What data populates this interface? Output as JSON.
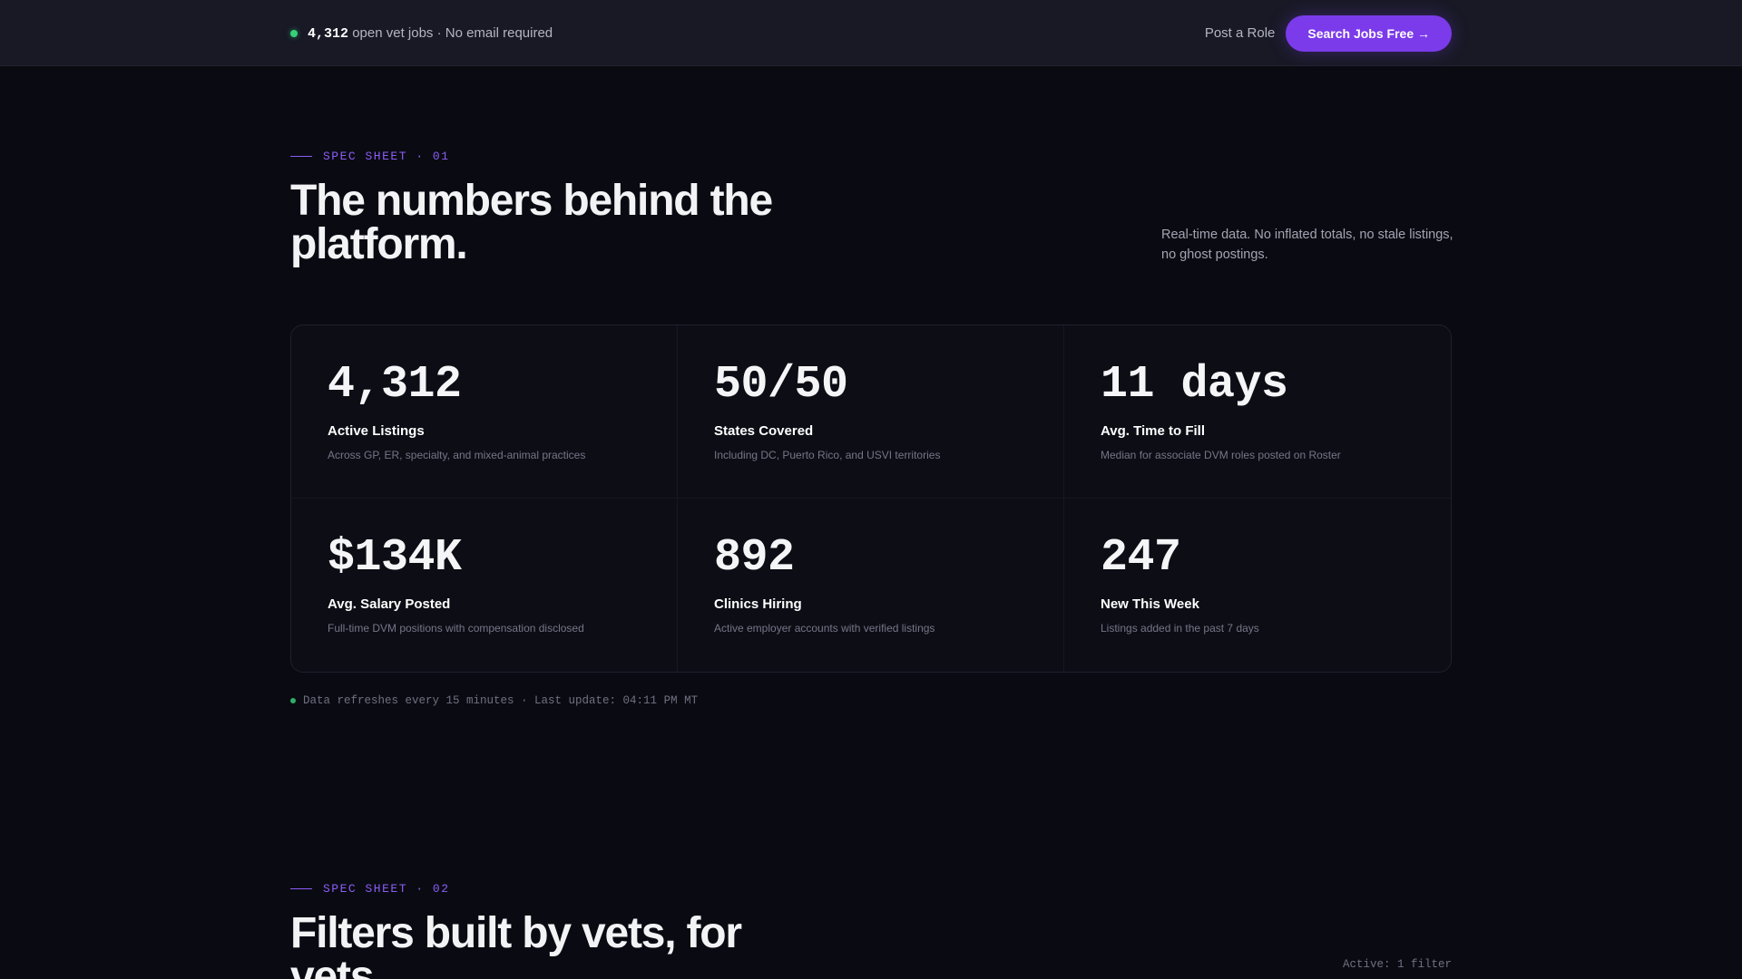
{
  "topbar": {
    "open_count": "4,312",
    "open_text": "open vet jobs · No email required",
    "post_role": "Post a Role",
    "search_button": "Search Jobs Free →"
  },
  "section1": {
    "eyebrow": "SPEC SHEET · 01",
    "title_line1": "The numbers behind the",
    "title_line2": "platform.",
    "description": "Real-time data. No inflated totals, no stale listings, no ghost postings.",
    "stats": [
      {
        "value": "4,312",
        "label": "Active Listings",
        "sub": "Across GP, ER, specialty, and mixed-animal practices"
      },
      {
        "value": "50/50",
        "label": "States Covered",
        "sub": "Including DC, Puerto Rico, and USVI territories"
      },
      {
        "value": "11 days",
        "label": "Avg. Time to Fill",
        "sub": "Median for associate DVM roles posted on Roster"
      },
      {
        "value": "$134K",
        "label": "Avg. Salary Posted",
        "sub": "Full-time DVM positions with compensation disclosed"
      },
      {
        "value": "892",
        "label": "Clinics Hiring",
        "sub": "Active employer accounts with verified listings"
      },
      {
        "value": "247",
        "label": "New This Week",
        "sub": "Listings added in the past 7 days"
      }
    ],
    "refresh_note": "Data refreshes every 15 minutes · Last update: 04:11 PM MT"
  },
  "section2": {
    "eyebrow": "SPEC SHEET · 02",
    "title_line1": "Filters built by vets, for",
    "title_line2": "vets.",
    "active_filter": "Active: 1 filter"
  },
  "colors": {
    "accent": "#7b3bea",
    "live": "#36d07a",
    "background": "#0a0b12"
  }
}
